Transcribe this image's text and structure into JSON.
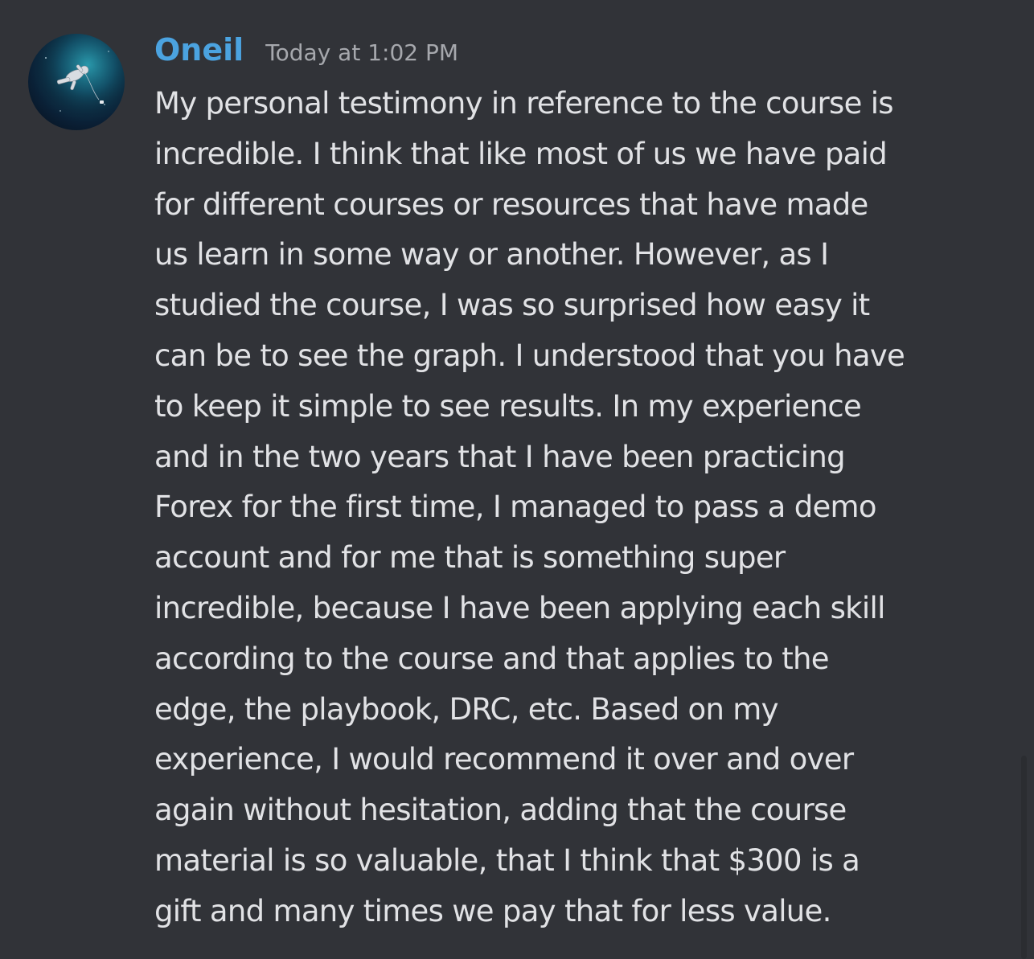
{
  "message": {
    "author": "Oneil",
    "timestamp": "Today at 1:02 PM",
    "lines": [
      "My personal testimony in reference to the course is",
      "incredible. I think that like most of us we have paid",
      "for different courses or resources that have made",
      "us learn in some way or another. However, as I",
      "studied the course, I was so surprised how easy it",
      "can be to see the graph. I understood that you have",
      "to keep it simple to see results. In my experience",
      "and in the two years that I have been practicing",
      "Forex for the first time, I managed to pass a demo",
      "account and for me that is something super",
      "incredible, because I have been applying each skill",
      "according to the course and that applies to the",
      "edge, the playbook, DRC, etc. Based on my",
      "experience, I would recommend it over and over",
      "again without hesitation, adding that the course",
      "material is so valuable, that I think that $300 is a",
      "gift and many times we pay that for less value."
    ]
  },
  "avatar": {
    "icon": "astronaut-avatar-icon"
  },
  "colors": {
    "background": "#313338",
    "author": "#4ba3e0",
    "timestamp": "#a6a8ad",
    "text": "#e1e2e5"
  }
}
